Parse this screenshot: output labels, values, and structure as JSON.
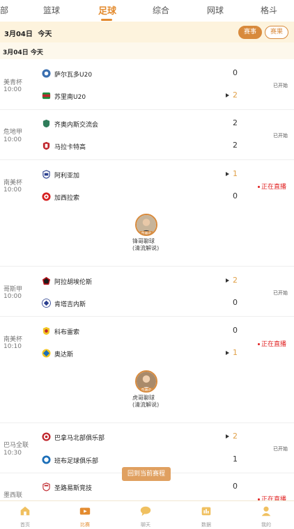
{
  "tabs": {
    "partial_left": "部",
    "basketball": "篮球",
    "football": "足球",
    "comprehensive": "综合",
    "tennis": "网球",
    "fighting": "格斗"
  },
  "date_header": {
    "date": "3月04日",
    "day": "今天",
    "schedule_btn": "赛事",
    "result_btn": "赛果"
  },
  "date_sub": {
    "label": "3月04日  今天"
  },
  "matches": [
    {
      "league": "美青杯",
      "time": "10:00",
      "home": {
        "name": "萨尔瓦多U20",
        "score": "0",
        "highlight": false,
        "arrow": false
      },
      "away": {
        "name": "苏里南U20",
        "score": "2",
        "highlight": true,
        "arrow": true
      },
      "status": "已开始",
      "live": false
    },
    {
      "league": "危地甲",
      "time": "10:00",
      "home": {
        "name": "齐奥内斯交流会",
        "score": "2",
        "highlight": false,
        "arrow": false
      },
      "away": {
        "name": "马拉卡特高",
        "score": "2",
        "highlight": false,
        "arrow": false
      },
      "status": "已开始",
      "live": false
    },
    {
      "league": "南美杯",
      "time": "10:00",
      "home": {
        "name": "阿利亚加",
        "score": "1",
        "highlight": true,
        "arrow": true
      },
      "away": {
        "name": "加西拉索",
        "score": "0",
        "highlight": false,
        "arrow": false
      },
      "status": "正在直播",
      "live": true,
      "anchor": {
        "badge": "直播中",
        "name": "锋哥聊球(清流解说)"
      }
    },
    {
      "league": "哥斯甲",
      "time": "10:00",
      "home": {
        "name": "阿拉胡埃伦斯",
        "score": "2",
        "highlight": true,
        "arrow": true
      },
      "away": {
        "name": "肯塔吉内斯",
        "score": "0",
        "highlight": false,
        "arrow": false
      },
      "status": "已开始",
      "live": false
    },
    {
      "league": "南美杯",
      "time": "10:10",
      "home": {
        "name": "科布雷索",
        "score": "0",
        "highlight": false,
        "arrow": false
      },
      "away": {
        "name": "奥达斯",
        "score": "1",
        "highlight": true,
        "arrow": true
      },
      "status": "正在直播",
      "live": true,
      "anchor": {
        "badge": "直播中",
        "name": "虎哥聊球(清流解说)"
      }
    },
    {
      "league": "巴马全联",
      "time": "10:30",
      "home": {
        "name": "巴拿马北部俱乐部",
        "score": "2",
        "highlight": true,
        "arrow": true
      },
      "away": {
        "name": "班布足球俱乐部",
        "score": "1",
        "highlight": false,
        "arrow": false
      },
      "status": "已开始",
      "live": false
    },
    {
      "league": "墨西联",
      "time": "",
      "home": {
        "name": "圣路易斯竞技",
        "score": "0",
        "highlight": false,
        "arrow": false
      },
      "status": "正在直播",
      "live": true
    }
  ],
  "back_button": "回到当前赛程",
  "bottom_nav": [
    {
      "label": "首页",
      "icon": "home-icon",
      "active": false
    },
    {
      "label": "比赛",
      "icon": "match-icon",
      "active": true
    },
    {
      "label": "聊天",
      "icon": "chat-icon",
      "active": false
    },
    {
      "label": "数据",
      "icon": "data-icon",
      "active": false
    },
    {
      "label": "我的",
      "icon": "profile-icon",
      "active": false
    }
  ],
  "colors": {
    "accent": "#e38b2f",
    "header_bg": "#fdf3dd",
    "live": "#e02020",
    "score_highlight": "#e0a048"
  }
}
